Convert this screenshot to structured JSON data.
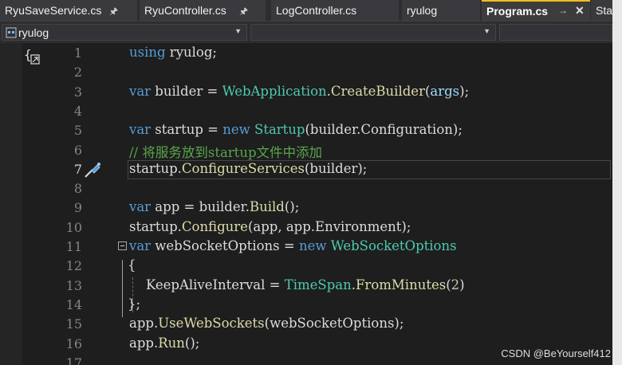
{
  "tabs": [
    {
      "label": "RyuSaveService.cs",
      "pinned": true
    },
    {
      "label": "RyuController.cs",
      "pinned": true
    },
    {
      "label": "LogController.cs",
      "pinned": false
    },
    {
      "label": "ryulog",
      "pinned": false
    },
    {
      "label": "Program.cs",
      "active": true,
      "pinned": true,
      "closable": true
    },
    {
      "label": "Sta"
    }
  ],
  "navbar": {
    "project": "ryulog"
  },
  "line_numbers": [
    "1",
    "2",
    "3",
    "4",
    "5",
    "6",
    "7",
    "8",
    "9",
    "10",
    "11",
    "12",
    "13",
    "14",
    "15",
    "16",
    "17"
  ],
  "code_lines": [
    [
      {
        "t": "using",
        "c": "kw"
      },
      {
        "t": " ryulog;",
        "c": ""
      }
    ],
    [],
    [
      {
        "t": "var",
        "c": "kw"
      },
      {
        "t": " builder = ",
        "c": ""
      },
      {
        "t": "WebApplication",
        "c": "ty"
      },
      {
        "t": ".",
        "c": ""
      },
      {
        "t": "CreateBuilder",
        "c": "me"
      },
      {
        "t": "(",
        "c": ""
      },
      {
        "t": "args",
        "c": "va"
      },
      {
        "t": ");",
        "c": ""
      }
    ],
    [],
    [
      {
        "t": "var",
        "c": "kw"
      },
      {
        "t": " startup = ",
        "c": ""
      },
      {
        "t": "new",
        "c": "kw"
      },
      {
        "t": " ",
        "c": ""
      },
      {
        "t": "Startup",
        "c": "ty"
      },
      {
        "t": "(builder.Configuration);",
        "c": ""
      }
    ],
    [
      {
        "t": "// 将服务放到startup文件中添加",
        "c": "cm"
      }
    ],
    [
      {
        "t": "startup.",
        "c": ""
      },
      {
        "t": "ConfigureServices",
        "c": "me"
      },
      {
        "t": "(builder);",
        "c": ""
      }
    ],
    [],
    [
      {
        "t": "var",
        "c": "kw"
      },
      {
        "t": " app = builder.",
        "c": ""
      },
      {
        "t": "Build",
        "c": "me"
      },
      {
        "t": "();",
        "c": ""
      }
    ],
    [
      {
        "t": "startup.",
        "c": ""
      },
      {
        "t": "Configure",
        "c": "me"
      },
      {
        "t": "(app, app.Environment);",
        "c": ""
      }
    ],
    [
      {
        "t": "var",
        "c": "kw"
      },
      {
        "t": " webSocketOptions = ",
        "c": ""
      },
      {
        "t": "new",
        "c": "kw"
      },
      {
        "t": " ",
        "c": ""
      },
      {
        "t": "WebSocketOptions",
        "c": "ty"
      }
    ],
    [
      {
        "t": "{",
        "c": ""
      }
    ],
    [
      {
        "t": "    KeepAliveInterval = ",
        "c": ""
      },
      {
        "t": "TimeSpan",
        "c": "ty"
      },
      {
        "t": ".",
        "c": ""
      },
      {
        "t": "FromMinutes",
        "c": "me"
      },
      {
        "t": "(",
        "c": ""
      },
      {
        "t": "2",
        "c": "nu"
      },
      {
        "t": ")",
        "c": ""
      }
    ],
    [
      {
        "t": "};",
        "c": ""
      }
    ],
    [
      {
        "t": "app.",
        "c": ""
      },
      {
        "t": "UseWebSockets",
        "c": "me"
      },
      {
        "t": "(webSocketOptions);",
        "c": ""
      }
    ],
    [
      {
        "t": "app.",
        "c": ""
      },
      {
        "t": "Run",
        "c": "me"
      },
      {
        "t": "();",
        "c": ""
      }
    ],
    []
  ],
  "current_line": 7,
  "watermark": "CSDN @BeYourself412",
  "colors": {
    "keyword": "#569cd6",
    "type": "#4ec9b0",
    "method": "#dcdcaa",
    "comment": "#57a64a",
    "accent_tab": "#f1bd1d"
  }
}
